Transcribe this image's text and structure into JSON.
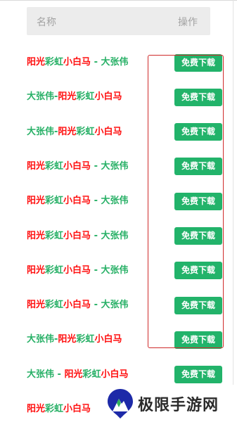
{
  "header": {
    "name_label": "名称",
    "action_label": "操作"
  },
  "colors": {
    "red": "#ff0f0f",
    "green": "#27b066",
    "button": "#22b36a",
    "highlight_border": "#cf2b2b"
  },
  "rows": [
    {
      "segments": [
        {
          "text": "阳光",
          "color": "red"
        },
        {
          "text": "彩虹",
          "color": "green"
        },
        {
          "text": "小白马",
          "color": "red"
        },
        {
          "text": " - 大张伟",
          "color": "green"
        }
      ],
      "button_label": "免费下载"
    },
    {
      "segments": [
        {
          "text": "大张伟-",
          "color": "green"
        },
        {
          "text": "阳光",
          "color": "red"
        },
        {
          "text": "彩虹",
          "color": "green"
        },
        {
          "text": "小白马",
          "color": "red"
        }
      ],
      "button_label": "免费下载"
    },
    {
      "segments": [
        {
          "text": "大张伟-",
          "color": "green"
        },
        {
          "text": "阳光",
          "color": "red"
        },
        {
          "text": "彩虹",
          "color": "green"
        },
        {
          "text": "小白马",
          "color": "red"
        }
      ],
      "button_label": "免费下载"
    },
    {
      "segments": [
        {
          "text": "阳光",
          "color": "red"
        },
        {
          "text": "彩虹",
          "color": "green"
        },
        {
          "text": "小白马",
          "color": "red"
        },
        {
          "text": " - 大张伟",
          "color": "green"
        }
      ],
      "button_label": "免费下载"
    },
    {
      "segments": [
        {
          "text": "阳光",
          "color": "red"
        },
        {
          "text": "彩虹",
          "color": "green"
        },
        {
          "text": "小白马",
          "color": "red"
        },
        {
          "text": " - 大张伟",
          "color": "green"
        }
      ],
      "button_label": "免费下载"
    },
    {
      "segments": [
        {
          "text": "阳光",
          "color": "red"
        },
        {
          "text": "彩虹",
          "color": "green"
        },
        {
          "text": "小白马",
          "color": "red"
        },
        {
          "text": " - 大张伟",
          "color": "green"
        }
      ],
      "button_label": "免费下载"
    },
    {
      "segments": [
        {
          "text": "阳光",
          "color": "red"
        },
        {
          "text": "彩虹",
          "color": "green"
        },
        {
          "text": "小白马",
          "color": "red"
        },
        {
          "text": " - 大张伟",
          "color": "green"
        }
      ],
      "button_label": "免费下载"
    },
    {
      "segments": [
        {
          "text": "阳光",
          "color": "red"
        },
        {
          "text": "彩虹",
          "color": "green"
        },
        {
          "text": "小白马",
          "color": "red"
        },
        {
          "text": " - 大张伟",
          "color": "green"
        }
      ],
      "button_label": "免费下载"
    },
    {
      "segments": [
        {
          "text": "大张伟-",
          "color": "green"
        },
        {
          "text": "阳光",
          "color": "red"
        },
        {
          "text": "彩虹",
          "color": "green"
        },
        {
          "text": "小白马",
          "color": "red"
        }
      ],
      "button_label": "免费下载"
    },
    {
      "segments": [
        {
          "text": "大张伟 - ",
          "color": "green"
        },
        {
          "text": "阳光",
          "color": "red"
        },
        {
          "text": "彩虹",
          "color": "green"
        },
        {
          "text": "小白马",
          "color": "red"
        }
      ],
      "button_label": "免费下载"
    },
    {
      "segments": [
        {
          "text": "阳光",
          "color": "red"
        },
        {
          "text": "彩虹",
          "color": "green"
        },
        {
          "text": "小白马",
          "color": "red"
        }
      ],
      "button_label": null
    }
  ],
  "watermark": {
    "site_name": "极限手游网",
    "logo_icon": "mountain-logo-icon"
  }
}
